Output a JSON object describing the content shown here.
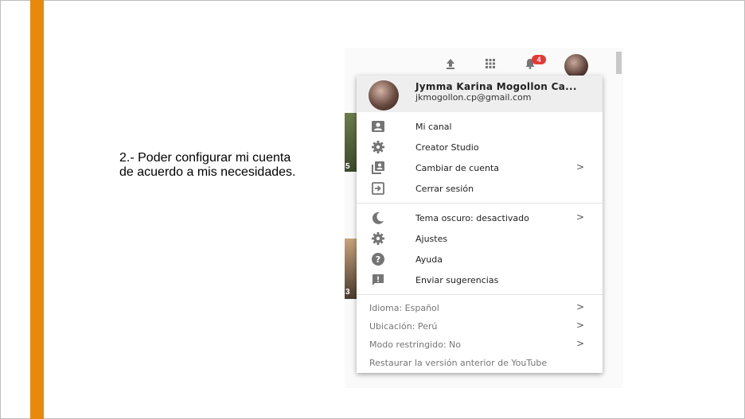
{
  "slide": {
    "caption": "2.- Poder configurar mi cuenta de acuerdo a mis necesidades."
  },
  "screenshot": {
    "thumbnail_numbers": [
      "5",
      "3"
    ],
    "topbar": {
      "icons": [
        "upload-icon",
        "apps-icon",
        "bell-icon"
      ],
      "notification_count": "4"
    }
  },
  "menu": {
    "user": {
      "name": "Jymma Karina Mogollon Ca...",
      "email": "jkmogollon.cp@gmail.com"
    },
    "section1": [
      {
        "label": "Mi canal",
        "icon": "person-icon"
      },
      {
        "label": "Creator Studio",
        "icon": "gear-icon"
      },
      {
        "label": "Cambiar de cuenta",
        "icon": "switch-account-icon",
        "chevron": ">"
      },
      {
        "label": "Cerrar sesión",
        "icon": "sign-out-icon"
      }
    ],
    "section2": [
      {
        "label": "Tema oscuro: desactivado",
        "icon": "moon-icon",
        "chevron": ">"
      },
      {
        "label": "Ajustes",
        "icon": "gear-icon"
      },
      {
        "label": "Ayuda",
        "icon": "help-icon"
      },
      {
        "label": "Enviar sugerencias",
        "icon": "feedback-icon"
      }
    ],
    "section3": [
      {
        "label": "Idioma: Español",
        "chevron": ">"
      },
      {
        "label": "Ubicación: Perú",
        "chevron": ">"
      },
      {
        "label": "Modo restringido: No",
        "chevron": ">"
      },
      {
        "label": "Restaurar la versión anterior de YouTube"
      }
    ]
  },
  "colors": {
    "accent_bar": "#e8890c",
    "badge": "#e53935",
    "icon_gray": "#757575"
  }
}
